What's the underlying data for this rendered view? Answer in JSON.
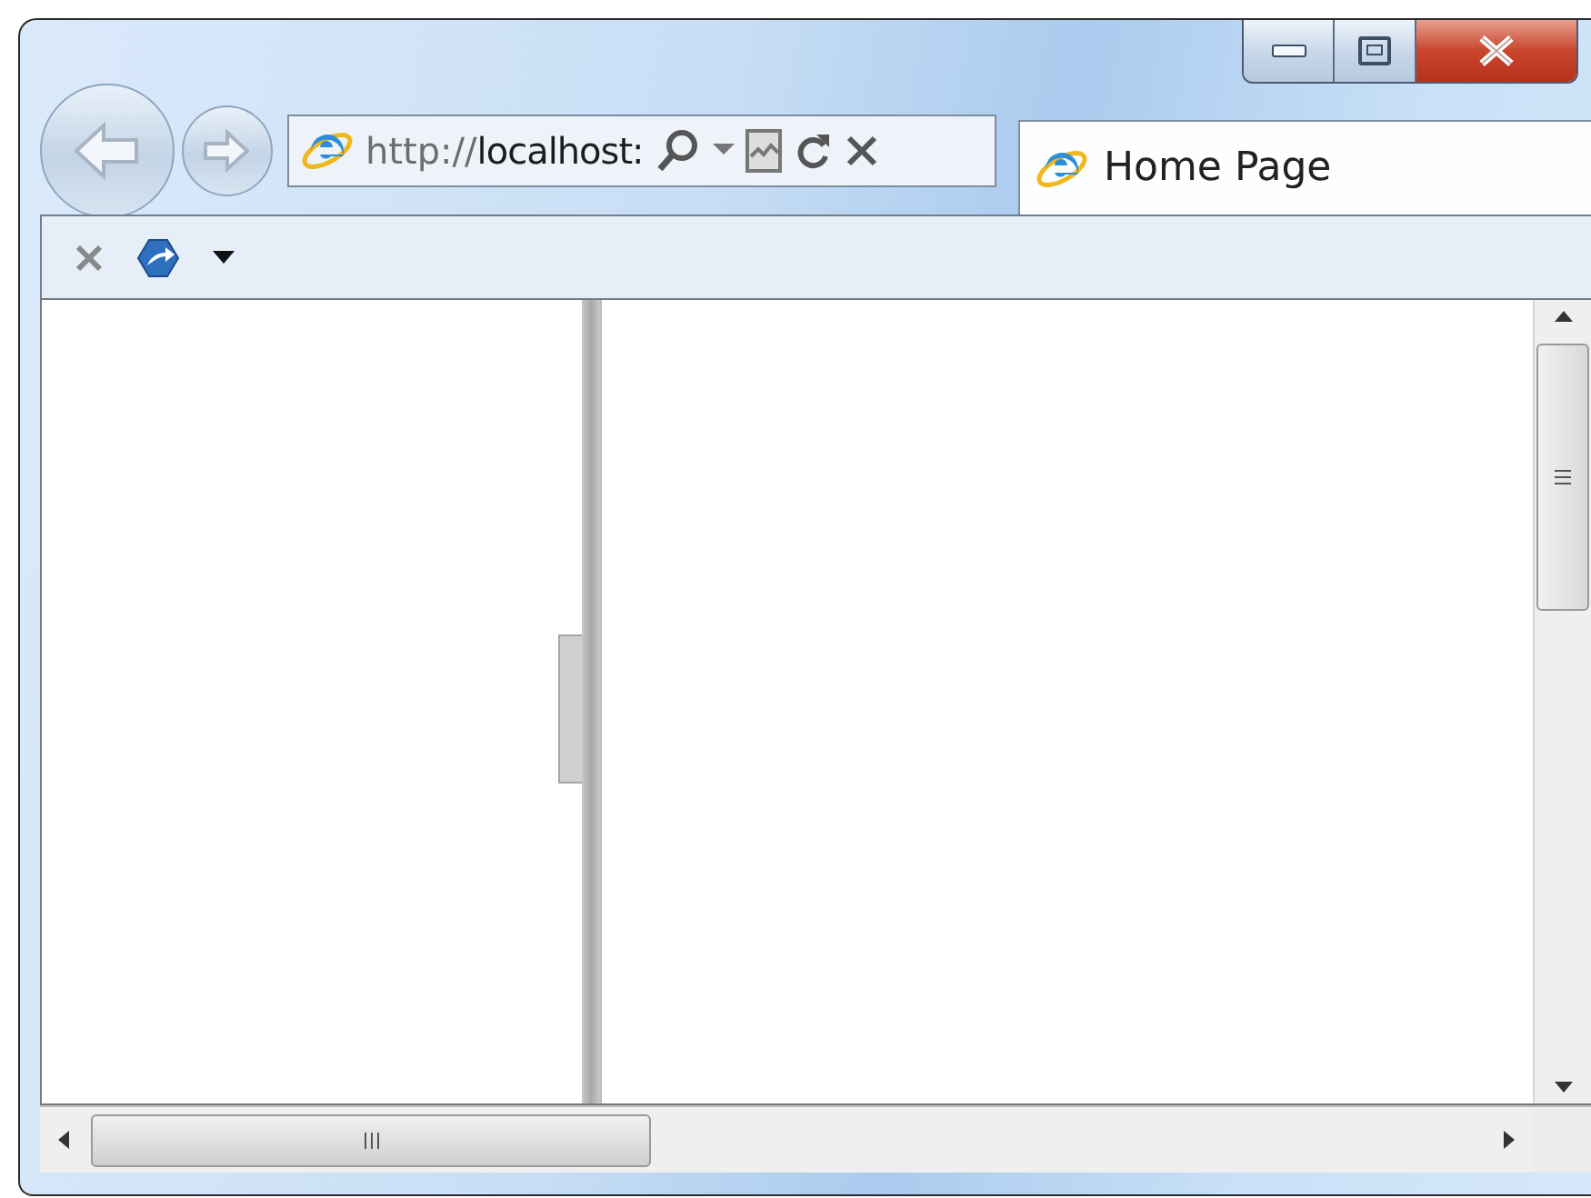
{
  "address_bar": {
    "scheme": "http://",
    "host": "localhost:"
  },
  "tabs": [
    {
      "label": "Home Page",
      "selected": true
    }
  ]
}
